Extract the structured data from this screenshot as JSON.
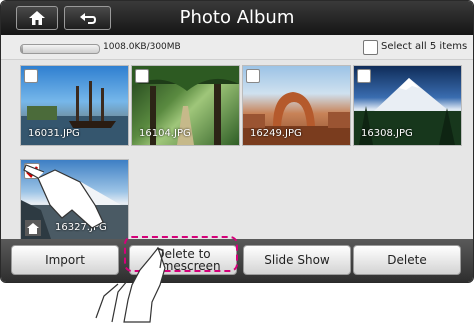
{
  "window": {
    "title": "Photo Album"
  },
  "toolbar": {
    "home_icon": "home-icon",
    "back_icon": "back-arrow-icon"
  },
  "storage": {
    "text": "1008.0KB/300MB",
    "used_fraction": 0.0033
  },
  "select_all": {
    "label": "Select all 5 items",
    "checked": false
  },
  "photos": [
    {
      "name": "16031.JPG",
      "checked": false
    },
    {
      "name": "16104.JPG",
      "checked": false
    },
    {
      "name": "16249.JPG",
      "checked": false
    },
    {
      "name": "16308.JPG",
      "checked": false
    },
    {
      "name": "16327.JPG",
      "checked": true
    }
  ],
  "actions": {
    "import": "Import",
    "delete_homescreen_line1": "Delete to",
    "delete_homescreen_line2": "Homescreen",
    "slide_show": "Slide Show",
    "delete": "Delete"
  },
  "colors": {
    "highlight": "#d6007a",
    "check": "#d10000"
  }
}
